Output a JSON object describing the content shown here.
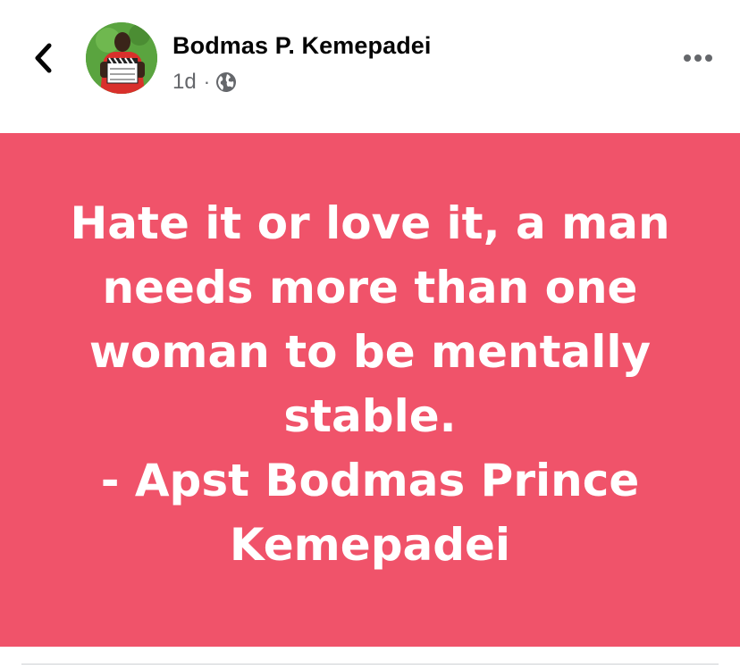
{
  "header": {
    "back_icon": "chevron-left-icon",
    "author_name": "Bodmas P. Kemepadei",
    "timestamp": "1d",
    "separator": "·",
    "audience_icon": "globe-icon",
    "more_icon": "more-horizontal-icon"
  },
  "post": {
    "background_color": "#f0536a",
    "text_color": "#ffffff",
    "text": "Hate it or love it, a man needs more than one woman to be mentally stable.\n- Apst Bodmas Prince Kemepadei"
  }
}
